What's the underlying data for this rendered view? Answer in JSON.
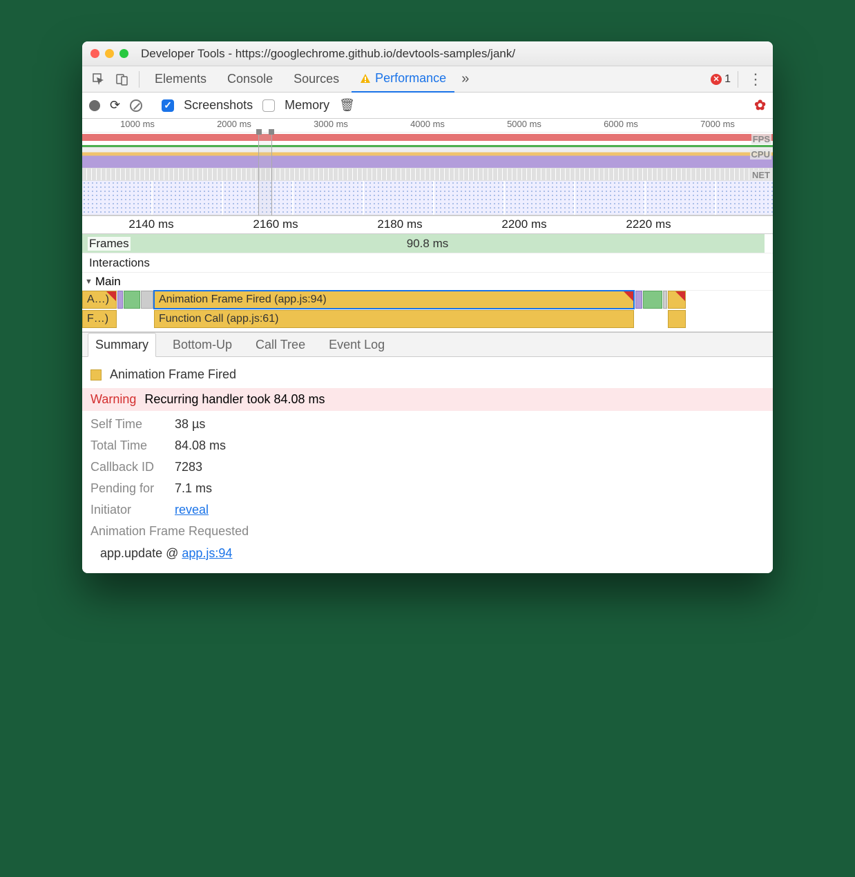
{
  "window": {
    "title": "Developer Tools - https://googlechrome.github.io/devtools-samples/jank/"
  },
  "tabs": {
    "items": [
      "Elements",
      "Console",
      "Sources",
      "Performance"
    ],
    "active": "Performance",
    "errors_count": "1"
  },
  "toolbar": {
    "screenshots_label": "Screenshots",
    "memory_label": "Memory",
    "screenshots_checked": true,
    "memory_checked": false
  },
  "overview": {
    "ticks": [
      "1000 ms",
      "2000 ms",
      "3000 ms",
      "4000 ms",
      "5000 ms",
      "6000 ms",
      "7000 ms"
    ],
    "tracks": [
      "FPS",
      "CPU",
      "NET"
    ]
  },
  "flame": {
    "ruler_ticks": [
      "2140 ms",
      "2160 ms",
      "2180 ms",
      "2200 ms",
      "2220 ms"
    ],
    "rows": {
      "frames": "Frames",
      "interactions": "Interactions",
      "main": "Main"
    },
    "frame_duration": "90.8 ms",
    "bar1_trunc": "A…)",
    "bar1": "Animation Frame Fired (app.js:94)",
    "bar2_trunc": "F…)",
    "bar2": "Function Call (app.js:61)"
  },
  "bottom_tabs": [
    "Summary",
    "Bottom-Up",
    "Call Tree",
    "Event Log"
  ],
  "summary": {
    "event_title": "Animation Frame Fired",
    "warning_label": "Warning",
    "warning_text": "Recurring handler took 84.08 ms",
    "self_time_label": "Self Time",
    "self_time": "38 µs",
    "total_time_label": "Total Time",
    "total_time": "84.08 ms",
    "callback_label": "Callback ID",
    "callback_id": "7283",
    "pending_label": "Pending for",
    "pending": "7.1 ms",
    "initiator_label": "Initiator",
    "initiator_link": "reveal",
    "afrq": "Animation Frame Requested",
    "stack_fn": "app.update @ ",
    "stack_link": "app.js:94"
  }
}
